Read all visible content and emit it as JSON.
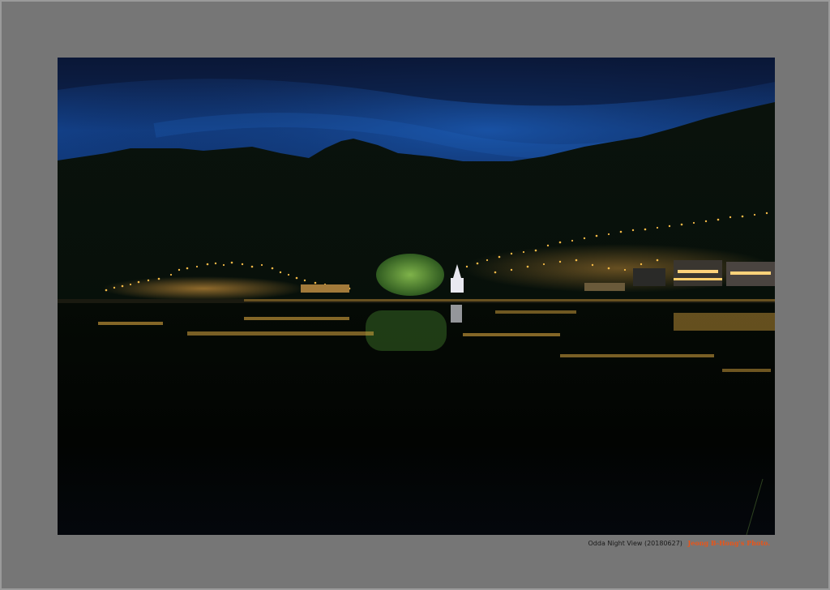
{
  "photo": {
    "alt": "Odda Night View",
    "colors": {
      "sky_top": "#0d1a3a",
      "sky_mid": "#13418a",
      "mountain": "#070d08",
      "lights": "#ffc24a",
      "water": "#020403"
    }
  },
  "caption": {
    "title": "Odda Night View (20180627)",
    "credit": "Jeong B-Hong's Photo."
  }
}
